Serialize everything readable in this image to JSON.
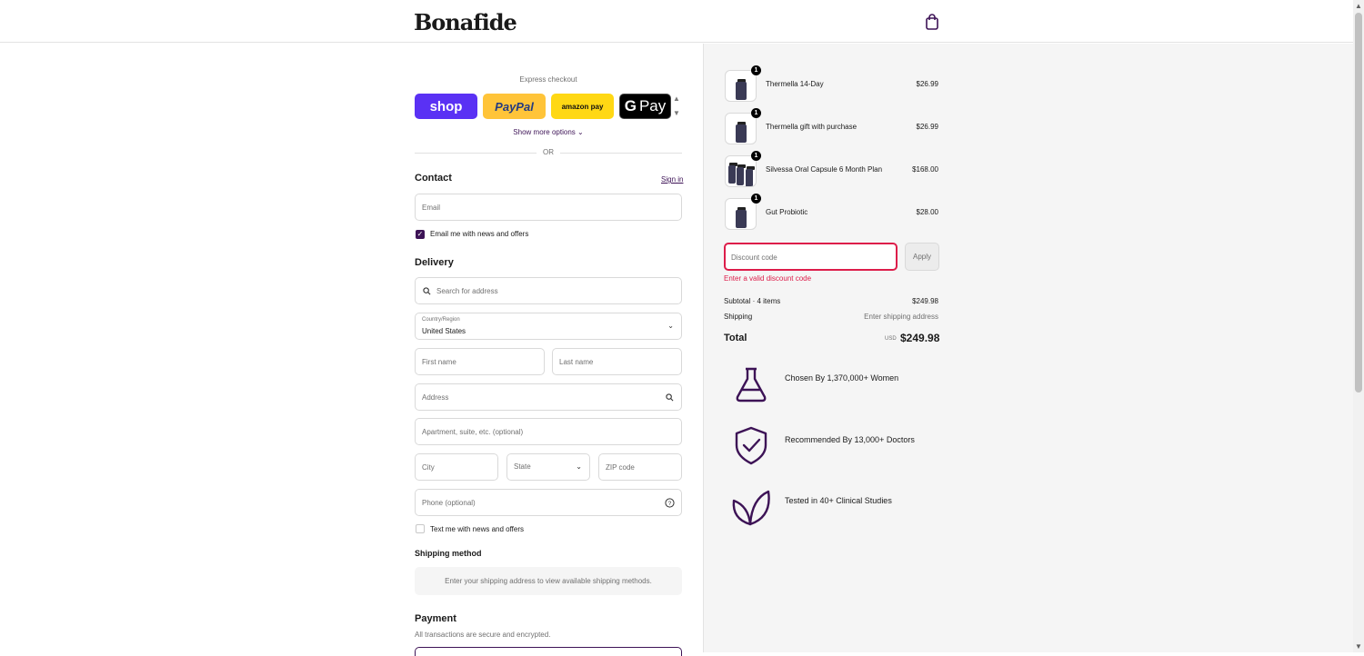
{
  "header": {
    "logo": "Bonafide",
    "cart_icon": "shopping-bag-icon"
  },
  "express": {
    "title": "Express checkout",
    "shop_label": "shop",
    "paypal_label": "PayPal",
    "amazon_label": "amazon pay",
    "gpay_g": "G",
    "gpay_label": "Pay",
    "show_more": "Show more options ⌄",
    "or": "OR"
  },
  "contact": {
    "title": "Contact",
    "sign_in": "Sign in",
    "email_placeholder": "Email",
    "email_opt_in": "Email me with news and offers",
    "email_opt_in_checked": true
  },
  "delivery": {
    "title": "Delivery",
    "search_placeholder": "Search for address",
    "country_label": "Country/Region",
    "country_value": "United States",
    "first_name": "First name",
    "last_name": "Last name",
    "address": "Address",
    "apartment": "Apartment, suite, etc. (optional)",
    "city": "City",
    "state": "State",
    "zip": "ZIP code",
    "phone": "Phone (optional)",
    "text_opt_in": "Text me with news and offers",
    "text_opt_in_checked": false
  },
  "shipping": {
    "title": "Shipping method",
    "message": "Enter your shipping address to view available shipping methods."
  },
  "payment": {
    "title": "Payment",
    "subtitle": "All transactions are secure and encrypted."
  },
  "cart": {
    "items": [
      {
        "name": "Thermella 14-Day",
        "price": "$26.99",
        "qty": "1"
      },
      {
        "name": "Thermella gift with purchase",
        "price": "$26.99",
        "qty": "1"
      },
      {
        "name": "Silvessa Oral Capsule 6 Month Plan",
        "price": "$168.00",
        "qty": "1"
      },
      {
        "name": "Gut Probiotic",
        "price": "$28.00",
        "qty": "1"
      }
    ],
    "discount_placeholder": "Discount code",
    "apply_label": "Apply",
    "discount_error": "Enter a valid discount code",
    "subtotal_label": "Subtotal · 4 items",
    "subtotal_value": "$249.98",
    "shipping_label": "Shipping",
    "shipping_value": "Enter shipping address",
    "total_label": "Total",
    "total_currency": "USD",
    "total_value": "$249.98"
  },
  "trust": [
    {
      "text": "Chosen By 1,370,000+ Women",
      "icon": "flask-icon"
    },
    {
      "text": "Recommended By 13,000+ Doctors",
      "icon": "shield-check-icon"
    },
    {
      "text": "Tested in 40+ Clinical Studies",
      "icon": "leaf-icon"
    }
  ],
  "colors": {
    "brand": "#3d1356",
    "error": "#dd1d4a",
    "shop": "#5a31f4",
    "paypal": "#ffc439",
    "amazon": "#ffd814"
  }
}
